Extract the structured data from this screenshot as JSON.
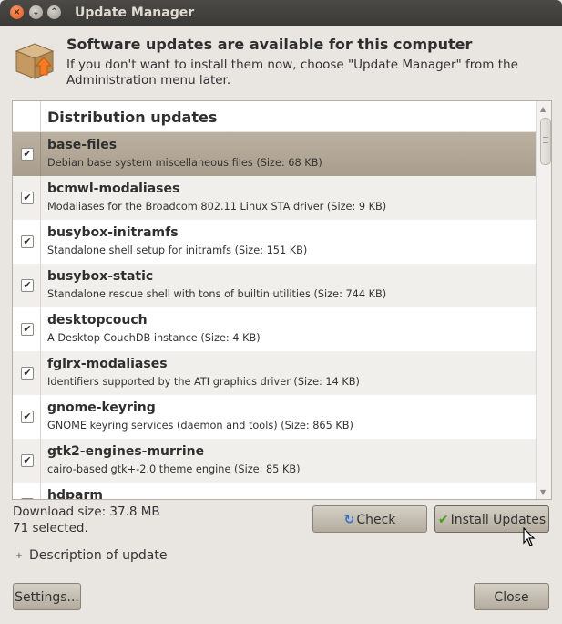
{
  "window": {
    "title": "Update Manager",
    "close_glyph": "×",
    "min_glyph": "⌄",
    "max_glyph": "⌃"
  },
  "header": {
    "icon": "package-update-icon",
    "title": "Software updates are available for this computer",
    "subtitle": "If you don't want to install them now, choose \"Update Manager\" from the Administration menu later."
  },
  "list": {
    "group_title": "Distribution updates",
    "rows": [
      {
        "name": "base-files",
        "desc": "Debian base system miscellaneous files (Size: 68 KB)",
        "checked": true,
        "selected": true
      },
      {
        "name": "bcmwl-modaliases",
        "desc": "Modaliases for the Broadcom 802.11 Linux STA driver (Size: 9 KB)",
        "checked": true
      },
      {
        "name": "busybox-initramfs",
        "desc": "Standalone shell setup for initramfs (Size: 151 KB)",
        "checked": true
      },
      {
        "name": "busybox-static",
        "desc": "Standalone rescue shell with tons of builtin utilities (Size: 744 KB)",
        "checked": true
      },
      {
        "name": "desktopcouch",
        "desc": "A Desktop CouchDB instance (Size: 4 KB)",
        "checked": true
      },
      {
        "name": "fglrx-modaliases",
        "desc": "Identifiers supported by the ATI graphics driver (Size: 14 KB)",
        "checked": true
      },
      {
        "name": "gnome-keyring",
        "desc": "GNOME keyring services (daemon and tools) (Size: 865 KB)",
        "checked": true
      },
      {
        "name": "gtk2-engines-murrine",
        "desc": "cairo-based gtk+-2.0 theme engine (Size: 85 KB)",
        "checked": true
      },
      {
        "name": "hdparm",
        "desc": "",
        "checked": true
      }
    ],
    "check_glyph": "✔"
  },
  "status": {
    "download_size": "Download size: 37.8 MB",
    "selected": "71 selected."
  },
  "buttons": {
    "check": "Check",
    "install": "Install Updates",
    "settings": "Settings...",
    "close": "Close"
  },
  "expander": {
    "glyph": "+",
    "label": "Description of update"
  }
}
